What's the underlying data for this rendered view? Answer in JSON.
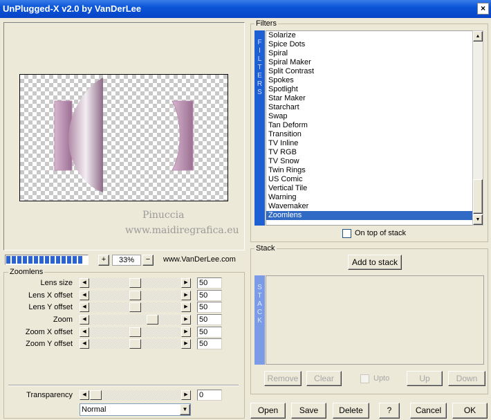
{
  "window": {
    "title": "UnPlugged-X v2.0 by VanDerLee",
    "close_label": "×"
  },
  "preview": {
    "watermark_line1": "Pinuccia",
    "watermark_line2": "www.maidiregrafica.eu"
  },
  "zoom": {
    "plus_label": "+",
    "value": "33%",
    "minus_label": "−",
    "link_text": "www.VanDerLee.com",
    "progress_segments": 14
  },
  "filters": {
    "group_label": "Filters",
    "side_label": "FILTERS",
    "items": [
      "Solarize",
      "Spice Dots",
      "Spiral",
      "Spiral Maker",
      "Split Contrast",
      "Spokes",
      "Spotlight",
      "Star Maker",
      "Starchart",
      "Swap",
      "Tan Deform",
      "Transition",
      "TV Inline",
      "TV RGB",
      "TV Snow",
      "Twin Rings",
      "US Comic",
      "Vertical Tile",
      "Warning",
      "Wavemaker",
      "Zoomlens"
    ],
    "selected_index": 20,
    "on_top_label": "On top of stack"
  },
  "stack": {
    "group_label": "Stack",
    "add_label": "Add to stack",
    "side_label": "STACK",
    "remove_label": "Remove",
    "clear_label": "Clear",
    "upto_label": "Upto",
    "up_label": "Up",
    "down_label": "Down"
  },
  "params": {
    "group_label": "Zoomlens",
    "rows": [
      {
        "label": "Lens size",
        "value": "50",
        "level": 0.5
      },
      {
        "label": "Lens X offset",
        "value": "50",
        "level": 0.5
      },
      {
        "label": "Lens Y offset",
        "value": "50",
        "level": 0.5
      },
      {
        "label": "Zoom",
        "value": "50",
        "level": 0.72
      },
      {
        "label": "Zoom X offset",
        "value": "50",
        "level": 0.5
      },
      {
        "label": "Zoom Y offset",
        "value": "50",
        "level": 0.5
      }
    ]
  },
  "transparency": {
    "label": "Transparency",
    "value": "0",
    "level": 0.0,
    "blend_mode": "Normal"
  },
  "footer": {
    "open_label": "Open",
    "save_label": "Save",
    "delete_label": "Delete",
    "help_label": "?",
    "cancel_label": "Cancel",
    "ok_label": "OK"
  }
}
